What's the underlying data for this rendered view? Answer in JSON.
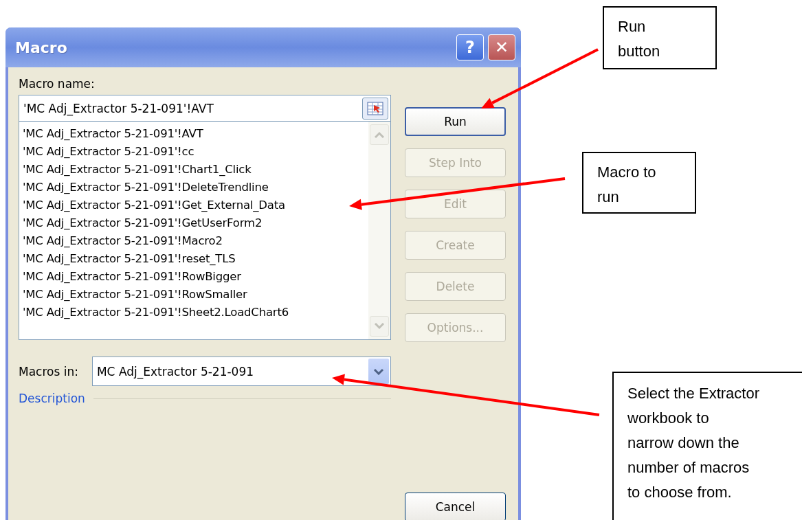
{
  "window": {
    "title": "Macro",
    "title_buttons": [
      "?",
      "✕"
    ]
  },
  "macro_name": {
    "label": "Macro name:",
    "value": "'MC Adj_Extractor 5-21-091'!AVT"
  },
  "macro_list": [
    {
      "label": "'MC Adj_Extractor 5-21-091'!AVT"
    },
    {
      "label": "'MC Adj_Extractor 5-21-091'!cc"
    },
    {
      "label": "'MC Adj_Extractor 5-21-091'!Chart1_Click"
    },
    {
      "label": "'MC Adj_Extractor 5-21-091'!DeleteTrendline"
    },
    {
      "label": "'MC Adj_Extractor 5-21-091'!Get_External_Data"
    },
    {
      "label": "'MC Adj_Extractor 5-21-091'!GetUserForm2"
    },
    {
      "label": "'MC Adj_Extractor 5-21-091'!Macro2"
    },
    {
      "label": "'MC Adj_Extractor 5-21-091'!reset_TLS"
    },
    {
      "label": "'MC Adj_Extractor 5-21-091'!RowBigger"
    },
    {
      "label": "'MC Adj_Extractor 5-21-091'!RowSmaller"
    },
    {
      "label": "'MC Adj_Extractor 5-21-091'!Sheet2.LoadChart6"
    }
  ],
  "buttons": [
    {
      "label": "Run",
      "disabled": false,
      "default": true
    },
    {
      "label": "Step Into",
      "disabled": true,
      "default": false
    },
    {
      "label": "Edit",
      "disabled": true,
      "default": false
    },
    {
      "label": "Create",
      "disabled": true,
      "default": false
    },
    {
      "label": "Delete",
      "disabled": true,
      "default": false
    },
    {
      "label": "Options...",
      "disabled": true,
      "default": false
    }
  ],
  "macros_in": {
    "label": "Macros in:",
    "value": "MC Adj_Extractor 5-21-091"
  },
  "description": {
    "label": "Description"
  },
  "cancel": {
    "label": "Cancel"
  },
  "callouts": [
    {
      "text": "Run\nbutton"
    },
    {
      "text": "Macro to\nrun"
    },
    {
      "text": "Select the Extractor\nworkbook to\nnarrow down the\nnumber of macros\nto choose from."
    }
  ]
}
